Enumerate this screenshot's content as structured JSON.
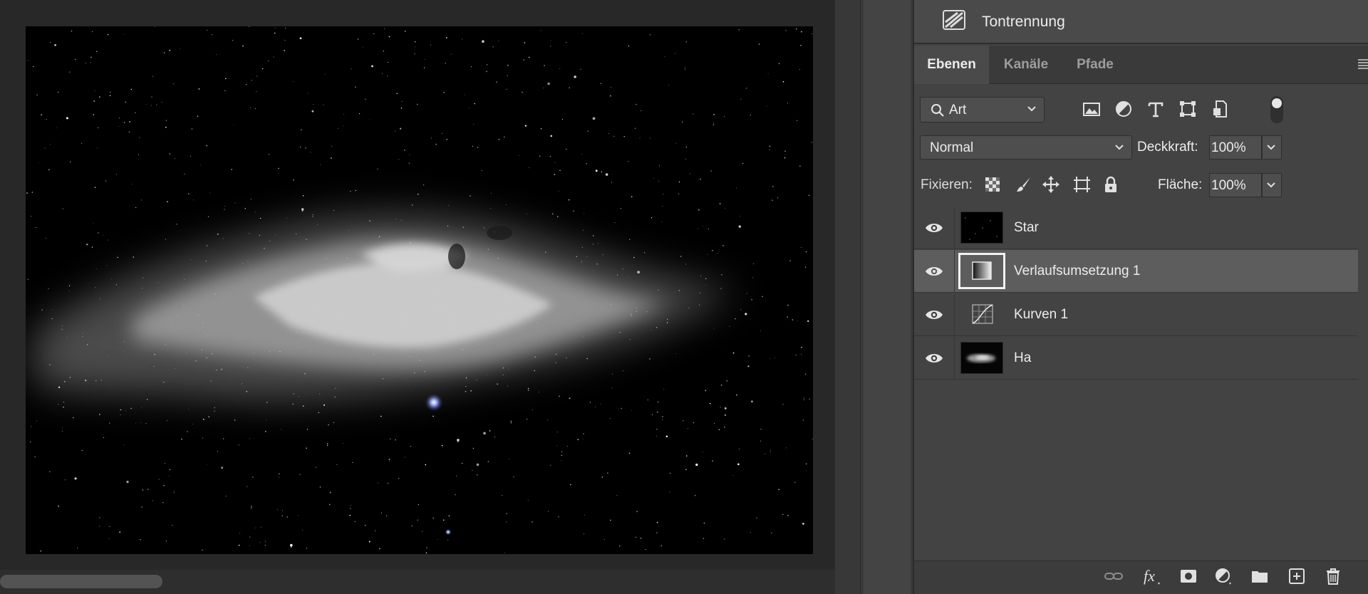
{
  "properties": {
    "title": "Tontrennung",
    "icon": "posterize-icon"
  },
  "tabs": [
    {
      "label": "Ebenen",
      "active": true
    },
    {
      "label": "Kanäle",
      "active": false
    },
    {
      "label": "Pfade",
      "active": false
    }
  ],
  "filter": {
    "kind_label": "Art",
    "icons": [
      "pixel-layer-filter-icon",
      "adjustment-layer-filter-icon",
      "type-layer-filter-icon",
      "shape-layer-filter-icon",
      "smart-object-filter-icon"
    ]
  },
  "blend": {
    "mode": "Normal",
    "opacity_label": "Deckkraft:",
    "opacity_value": "100%"
  },
  "lock": {
    "label": "Fixieren:",
    "icons": [
      "lock-transparent-pixels-icon",
      "lock-image-pixels-icon",
      "lock-position-icon",
      "lock-artboard-icon",
      "lock-all-icon"
    ],
    "fill_label": "Fläche:",
    "fill_value": "100%"
  },
  "layers": [
    {
      "name": "Star",
      "visible": true,
      "selected": false,
      "thumb": "stars"
    },
    {
      "name": "Verlaufsumsetzung 1",
      "visible": true,
      "selected": true,
      "thumb": "gradient-map"
    },
    {
      "name": "Kurven 1",
      "visible": true,
      "selected": false,
      "thumb": "curves"
    },
    {
      "name": "Ha",
      "visible": true,
      "selected": false,
      "thumb": "nebula"
    }
  ],
  "bottom_icons": [
    "link-layers-icon",
    "fx-icon",
    "layer-mask-icon",
    "adjustment-layer-icon",
    "group-folder-icon",
    "new-layer-icon",
    "trash-icon"
  ]
}
